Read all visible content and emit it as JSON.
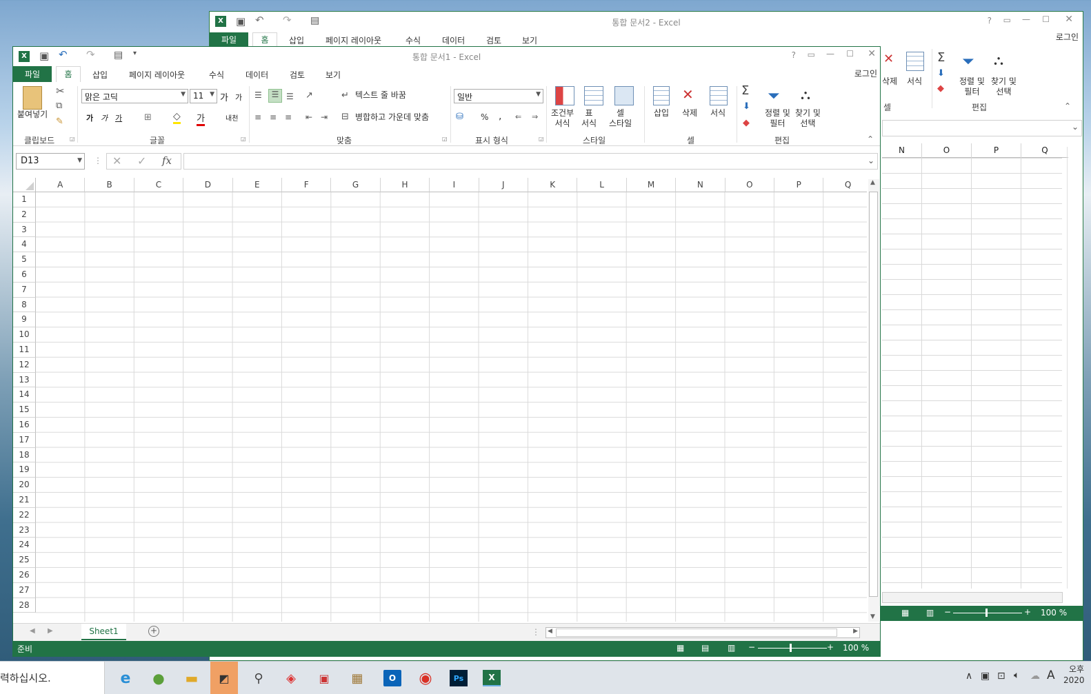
{
  "back_window": {
    "title": "통합 문서2 - Excel",
    "tabs": [
      "파일",
      "홈",
      "삽입",
      "페이지 레이아웃",
      "수식",
      "데이터",
      "검토",
      "보기"
    ],
    "login": "로그인",
    "ribbon_labels": {
      "delete": "삭제",
      "format": "서식",
      "sort": "정렬 및\n필터",
      "find": "찾기 및\n선택",
      "cells": "셀",
      "edit": "편집"
    },
    "columns": [
      "N",
      "O",
      "P",
      "Q"
    ],
    "zoom": "100 %"
  },
  "front_window": {
    "title": "통합 문서1 - Excel",
    "login": "로그인",
    "tabs": [
      "파일",
      "홈",
      "삽입",
      "페이지 레이아웃",
      "수식",
      "데이터",
      "검토",
      "보기"
    ],
    "ribbon": {
      "paste": "붙여넣기",
      "clipboard": "클립보드",
      "font_name": "맑은 고딕",
      "font_size": "11",
      "font_group": "글꼴",
      "wrap_text": "텍스트 줄 바꿈",
      "merge_center": "병합하고 가운데 맞춤",
      "alignment": "맞춤",
      "number_format": "일반",
      "number_group": "표시 형식",
      "cond_format": "조건부\n서식",
      "table_format": "표\n서식",
      "cell_style": "셀\n스타일",
      "styles": "스타일",
      "insert": "삽입",
      "delete": "삭제",
      "format": "서식",
      "cells": "셀",
      "sort_filter": "정렬 및\n필터",
      "find_select": "찾기 및\n선택",
      "editing": "편집",
      "bold": "가",
      "italic": "가",
      "underline": "가",
      "font_grow": "가",
      "font_shrink": "가",
      "font_color": "가",
      "phonetic": "내천",
      "percent": "%",
      "comma": ","
    },
    "name_box": "D13",
    "fx": "fx",
    "columns": [
      "A",
      "B",
      "C",
      "D",
      "E",
      "F",
      "G",
      "H",
      "I",
      "J",
      "K",
      "L",
      "M",
      "N",
      "O",
      "P",
      "Q"
    ],
    "rows": [
      "1",
      "2",
      "3",
      "4",
      "5",
      "6",
      "7",
      "8",
      "9",
      "10",
      "11",
      "12",
      "13",
      "14",
      "15",
      "16",
      "17",
      "18",
      "19",
      "20",
      "21",
      "22",
      "23",
      "24",
      "25",
      "26",
      "27",
      "28"
    ],
    "sheet_tab": "Sheet1",
    "status": "준비",
    "zoom": "100 %"
  },
  "desktop": {
    "taskbar_search": "력하십시오.",
    "tray_lang": "A",
    "tray_time": "오후",
    "tray_date": "2020"
  }
}
